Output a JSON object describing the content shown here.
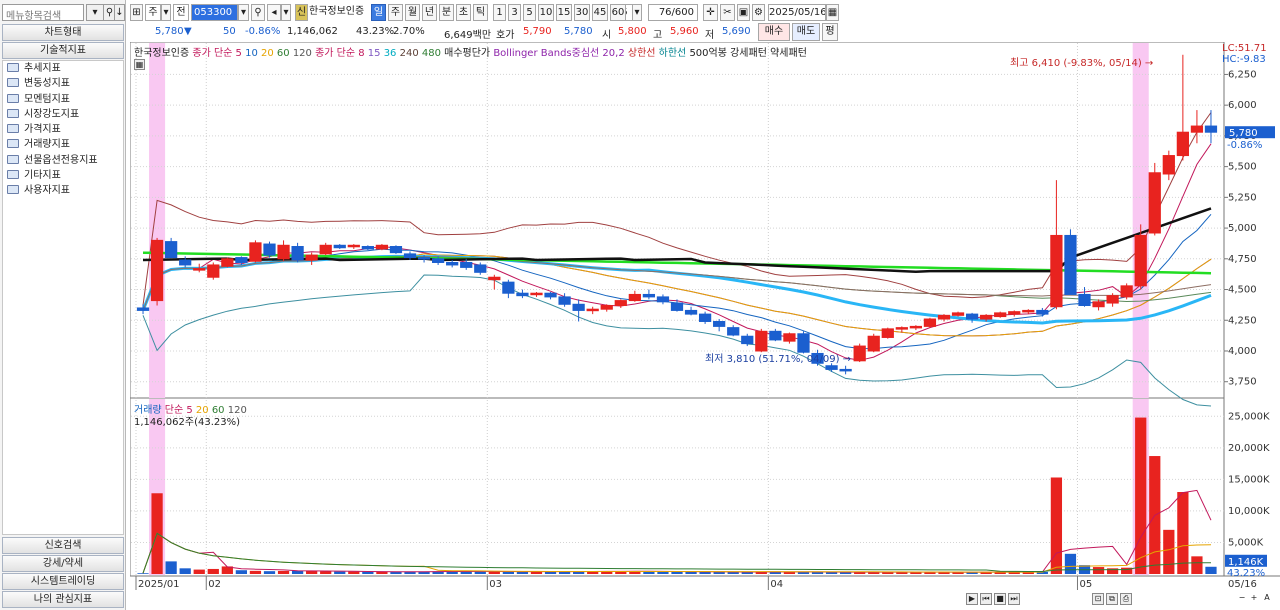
{
  "left": {
    "search_placeholder": "메뉴항목검색",
    "buttons": {
      "chart_type": "차트형태",
      "tech_indicator": "기술적지표"
    },
    "tree": [
      "추세지표",
      "변동성지표",
      "모멘텀지표",
      "시장강도지표",
      "가격지표",
      "거래량지표",
      "선물옵션전용지표",
      "기타지표",
      "사용자지표"
    ],
    "bottom": [
      "신호검색",
      "강세/약세",
      "시스템트레이딩",
      "나의 관심지표"
    ]
  },
  "toolbar": {
    "day_mode": "주",
    "prev_mode": "전",
    "code": "053300",
    "stock_name": "한국정보인증",
    "new_badge": "신",
    "periods": [
      "일",
      "주",
      "월",
      "년",
      "분",
      "초",
      "틱"
    ],
    "selected_period": "일",
    "intervals": [
      "1",
      "3",
      "5",
      "10",
      "15",
      "30",
      "45",
      "60"
    ],
    "custom_interval": "5",
    "count": "76/600",
    "date": "2025/05/16"
  },
  "quote": {
    "price": "5,780",
    "change": "50",
    "pct": "-0.86%",
    "volume": "1,146,062",
    "vol_pct": "43.23%",
    "rate": "2.70%",
    "amount": "6,649백만",
    "ask_label": "호가",
    "ask": "5,790",
    "bid": "5,780",
    "open_label": "시",
    "open": "5,800",
    "high_label": "고",
    "high": "5,960",
    "low_label": "저",
    "low": "5,690",
    "buy": "매수",
    "sell": "매도",
    "eval": "평"
  },
  "price_legend": [
    {
      "text": "한국정보인증",
      "color": "#222222"
    },
    {
      "text": "종가 단순 5",
      "color": "#c2185b"
    },
    {
      "text": "10",
      "color": "#1565c0"
    },
    {
      "text": "20",
      "color": "#e6a400"
    },
    {
      "text": "60",
      "color": "#2e7d32"
    },
    {
      "text": "120",
      "color": "#555555"
    },
    {
      "text": "종가 단순 8",
      "color": "#c2185b"
    },
    {
      "text": "15",
      "color": "#7e57c2"
    },
    {
      "text": "36",
      "color": "#00acc1"
    },
    {
      "text": "240",
      "color": "#5d4037"
    },
    {
      "text": "480",
      "color": "#2e7d32"
    },
    {
      "text": "매수평단가",
      "color": "#222222"
    },
    {
      "text": "Bollinger Bands중심선 20,2",
      "color": "#8e24aa"
    },
    {
      "text": "상한선",
      "color": "#c62828"
    },
    {
      "text": "하한선",
      "color": "#00838f"
    },
    {
      "text": "500억봉 강세패턴",
      "color": "#222222"
    },
    {
      "text": "약세패턴",
      "color": "#222222"
    }
  ],
  "vol_legend": [
    {
      "text": "거래량",
      "color": "#1565c0"
    },
    {
      "text": "단순 5",
      "color": "#c2185b"
    },
    {
      "text": "20",
      "color": "#e6a400"
    },
    {
      "text": "60",
      "color": "#2e7d32"
    },
    {
      "text": "120",
      "color": "#555555"
    }
  ],
  "vol_info": "1,146,062주(43.23%)",
  "lc_label": "LC:51.71",
  "hc_label": "HC:-9.83",
  "max_annotation": "최고 6,410 (-9.83%, 05/14)",
  "min_annotation": "최저 3,810 (51.71%, 04/09)",
  "last_price_tag": "5,780",
  "last_pct_tag": "-0.86%",
  "last_vol_tag": "1,146K",
  "last_vol_pct": "43.23%",
  "right_date": "05/16",
  "colors": {
    "up": "#e8231f",
    "down": "#1b5fcf",
    "highlight": "#f9c8f2",
    "sel_blue": "#3b7be0"
  },
  "chart_data": {
    "type": "candlestick",
    "price_axis_ticks": [
      "6,250",
      "6,000",
      "5,750",
      "5,500",
      "5,250",
      "5,000",
      "4,750",
      "4,500",
      "4,250",
      "4,000",
      "3,750"
    ],
    "price_ylim": [
      3650,
      6400
    ],
    "volume_axis_ticks": [
      "25,000K",
      "20,000K",
      "15,000K",
      "10,000K",
      "5,000K"
    ],
    "volume_ylim": [
      0,
      26000
    ],
    "x_labels": [
      {
        "i": 0,
        "text": "2025/01"
      },
      {
        "i": 5,
        "text": "02"
      },
      {
        "i": 25,
        "text": "03"
      },
      {
        "i": 45,
        "text": "04"
      },
      {
        "i": 67,
        "text": "05"
      }
    ],
    "highlight_bars": [
      1,
      71
    ],
    "candles": [
      [
        4350,
        4380,
        4300,
        4330
      ],
      [
        4410,
        4920,
        4370,
        4900
      ],
      [
        4890,
        4920,
        4760,
        4760
      ],
      [
        4740,
        4770,
        4680,
        4700
      ],
      [
        4660,
        4710,
        4640,
        4670
      ],
      [
        4600,
        4720,
        4580,
        4700
      ],
      [
        4690,
        4760,
        4680,
        4750
      ],
      [
        4760,
        4770,
        4700,
        4720
      ],
      [
        4730,
        4900,
        4720,
        4880
      ],
      [
        4870,
        4890,
        4760,
        4780
      ],
      [
        4750,
        4900,
        4730,
        4860
      ],
      [
        4850,
        4880,
        4720,
        4740
      ],
      [
        4740,
        4800,
        4700,
        4780
      ],
      [
        4790,
        4880,
        4780,
        4860
      ],
      [
        4860,
        4870,
        4830,
        4840
      ],
      [
        4850,
        4870,
        4830,
        4860
      ],
      [
        4850,
        4860,
        4820,
        4830
      ],
      [
        4830,
        4870,
        4820,
        4860
      ],
      [
        4850,
        4860,
        4790,
        4800
      ],
      [
        4790,
        4810,
        4740,
        4760
      ],
      [
        4760,
        4780,
        4720,
        4750
      ],
      [
        4750,
        4770,
        4700,
        4720
      ],
      [
        4720,
        4740,
        4680,
        4700
      ],
      [
        4720,
        4750,
        4660,
        4680
      ],
      [
        4700,
        4720,
        4620,
        4640
      ],
      [
        4580,
        4620,
        4500,
        4600
      ],
      [
        4560,
        4580,
        4430,
        4470
      ],
      [
        4470,
        4500,
        4430,
        4450
      ],
      [
        4460,
        4480,
        4440,
        4470
      ],
      [
        4470,
        4480,
        4420,
        4440
      ],
      [
        4440,
        4470,
        4360,
        4380
      ],
      [
        4380,
        4420,
        4240,
        4330
      ],
      [
        4330,
        4360,
        4300,
        4340
      ],
      [
        4340,
        4380,
        4320,
        4370
      ],
      [
        4370,
        4420,
        4350,
        4410
      ],
      [
        4410,
        4490,
        4400,
        4460
      ],
      [
        4460,
        4500,
        4420,
        4440
      ],
      [
        4440,
        4460,
        4380,
        4400
      ],
      [
        4390,
        4420,
        4320,
        4330
      ],
      [
        4330,
        4360,
        4290,
        4300
      ],
      [
        4300,
        4320,
        4220,
        4240
      ],
      [
        4240,
        4260,
        4160,
        4200
      ],
      [
        4190,
        4210,
        4120,
        4130
      ],
      [
        4120,
        4140,
        4040,
        4060
      ],
      [
        4000,
        4180,
        3990,
        4160
      ],
      [
        4160,
        4180,
        4080,
        4090
      ],
      [
        4080,
        4150,
        4060,
        4140
      ],
      [
        4140,
        4160,
        3980,
        3990
      ],
      [
        3980,
        4010,
        3880,
        3900
      ],
      [
        3880,
        3900,
        3830,
        3850
      ],
      [
        3850,
        3880,
        3810,
        3840
      ],
      [
        3920,
        4060,
        3910,
        4040
      ],
      [
        4000,
        4140,
        3990,
        4120
      ],
      [
        4110,
        4190,
        4100,
        4180
      ],
      [
        4180,
        4200,
        4150,
        4190
      ],
      [
        4190,
        4210,
        4170,
        4200
      ],
      [
        4200,
        4270,
        4190,
        4260
      ],
      [
        4260,
        4300,
        4240,
        4290
      ],
      [
        4290,
        4320,
        4280,
        4310
      ],
      [
        4300,
        4310,
        4230,
        4260
      ],
      [
        4260,
        4300,
        4240,
        4290
      ],
      [
        4280,
        4320,
        4270,
        4310
      ],
      [
        4300,
        4330,
        4280,
        4320
      ],
      [
        4320,
        4340,
        4300,
        4330
      ],
      [
        4330,
        4350,
        4280,
        4300
      ],
      [
        4360,
        5390,
        4340,
        4940
      ],
      [
        4940,
        4990,
        4470,
        4460
      ],
      [
        4460,
        4520,
        4360,
        4370
      ],
      [
        4360,
        4420,
        4330,
        4400
      ],
      [
        4390,
        4470,
        4360,
        4450
      ],
      [
        4440,
        4550,
        4420,
        4530
      ],
      [
        4530,
        5030,
        4500,
        4940
      ],
      [
        4960,
        5530,
        4940,
        5450
      ],
      [
        5440,
        5630,
        5390,
        5590
      ],
      [
        5590,
        6410,
        5550,
        5780
      ],
      [
        5780,
        5960,
        5690,
        5830
      ],
      [
        5830,
        5960,
        5690,
        5780
      ]
    ],
    "volumes": [
      120,
      12800,
      2000,
      900,
      700,
      800,
      1200,
      600,
      500,
      450,
      480,
      520,
      500,
      400,
      380,
      380,
      350,
      360,
      380,
      360,
      400,
      420,
      430,
      400,
      380,
      350,
      420,
      380,
      360,
      400,
      380,
      420,
      450,
      430,
      420,
      400,
      420,
      380,
      360,
      340,
      320,
      320,
      320,
      300,
      340,
      360,
      330,
      340,
      300,
      280,
      260,
      300,
      330,
      320,
      300,
      280,
      280,
      290,
      300,
      300,
      300,
      310,
      320,
      330,
      340,
      15300,
      3200,
      1400,
      1100,
      900,
      1000,
      24800,
      18700,
      7000,
      13000,
      2800,
      1146
    ]
  }
}
